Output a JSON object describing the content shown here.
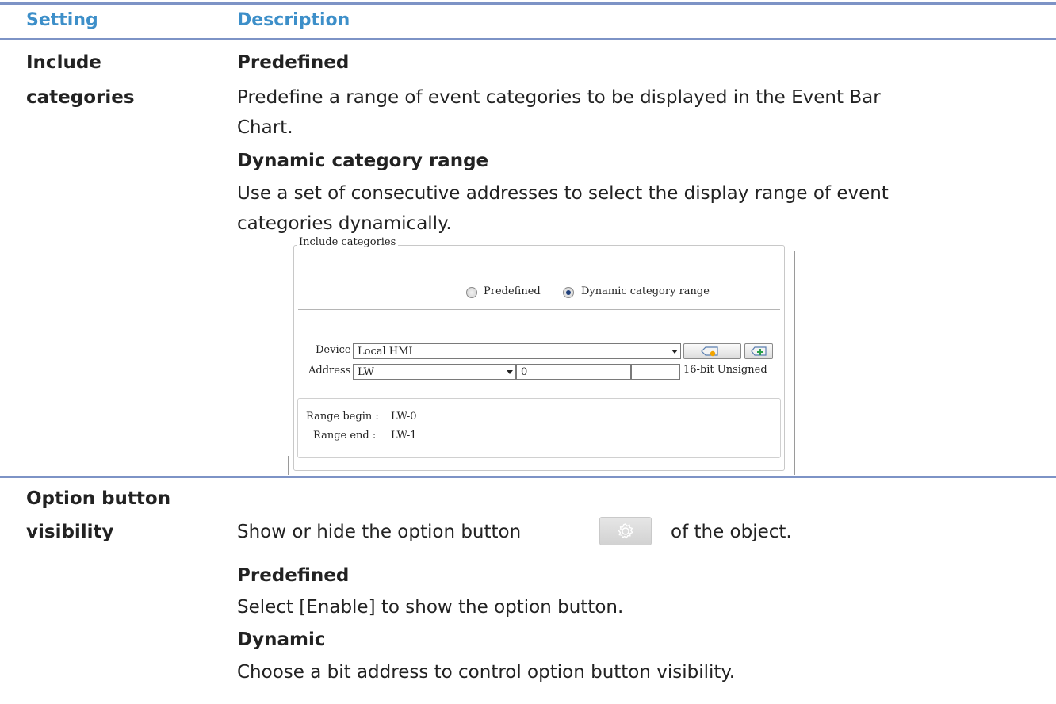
{
  "table": {
    "headers": {
      "setting": "Setting",
      "description": "Description"
    },
    "rows": [
      {
        "setting": [
          "Include",
          "categories"
        ],
        "items": [
          {
            "heading": "Predefined"
          },
          {
            "text_lines": [
              "Predefine a range of event categories to be displayed in the Event Bar",
              "Chart."
            ]
          },
          {
            "heading": "Dynamic category range"
          },
          {
            "text_lines": [
              "Use a set of consecutive addresses to select the display range of event",
              "categories dynamically."
            ]
          }
        ]
      },
      {
        "setting": [
          "Option button",
          "visibility"
        ],
        "items": [
          {
            "text_before_icon": "Show or hide the option button",
            "text_after_icon": "of the object.",
            "icon": "gear-icon"
          },
          {
            "heading": "Predefined"
          },
          {
            "text": "Select [Enable] to show the option button."
          },
          {
            "heading": "Dynamic"
          },
          {
            "text": "Choose a bit address to control option button visibility."
          }
        ]
      }
    ]
  },
  "dialog": {
    "group_title": "Include categories",
    "radio_predefined": "Predefined",
    "radio_dynamic": "Dynamic category range",
    "selected_radio": "Dynamic category range",
    "device_label": "Device :",
    "device_value": "Local HMI",
    "address_label": "Address :",
    "address_type": "LW",
    "address_value": "0",
    "data_format": "16-bit Unsigned",
    "range_begin_label": "Range begin :",
    "range_begin_value": "LW-0",
    "range_end_label": "Range end :",
    "range_end_value": "LW-1",
    "tag_icon": "tag-icon",
    "add_icon": "add-icon"
  },
  "colors": {
    "header_text": "#3d8fc9",
    "rule_lines": "#7d93c6",
    "radio_selected": "#1f3f7a"
  }
}
